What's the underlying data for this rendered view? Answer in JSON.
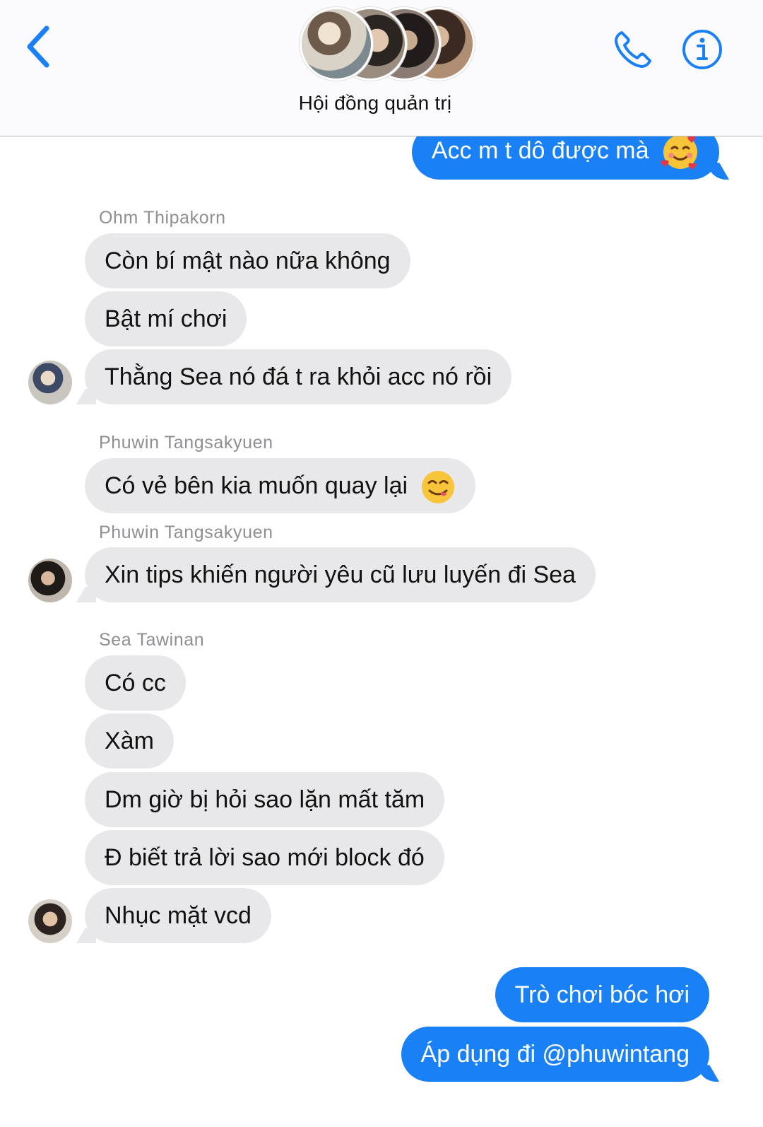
{
  "header": {
    "title": "Hội đồng quản trị",
    "back_icon": "chevron-left-icon",
    "call_icon": "phone-icon",
    "info_icon": "info-icon",
    "accent": "#1a80f5"
  },
  "messages": {
    "m0": {
      "text": "Acc m t dô được mà",
      "emoji": "smiling-face-with-hearts"
    },
    "ohm_name": "Ohm Thipakorn",
    "m1": "Còn bí mật nào nữa không",
    "m2": "Bật mí chơi",
    "m3": "Thằng Sea nó đá t ra khỏi acc nó rồi",
    "phuwin_name_1": "Phuwin Tangsakyuen",
    "m4": {
      "text": "Có vẻ bên kia muốn quay lại",
      "emoji": "face-savoring-food"
    },
    "phuwin_name_2": "Phuwin Tangsakyuen",
    "m5": "Xin tips khiến người yêu cũ lưu luyến đi Sea",
    "sea_name": "Sea Tawinan",
    "m6": "Có cc",
    "m7": "Xàm",
    "m8": "Dm giờ bị hỏi sao lặn mất tăm",
    "m9": "Đ biết trả lời sao mới block đó",
    "m10": "Nhục mặt vcd",
    "m11": "Trò chơi bóc hơi",
    "m12": "Áp dụng đi @phuwintang"
  },
  "colors": {
    "incoming_bubble": "#e8e8ea",
    "outgoing_bubble": "#1a80f5",
    "sender_name": "#8e8e93"
  }
}
